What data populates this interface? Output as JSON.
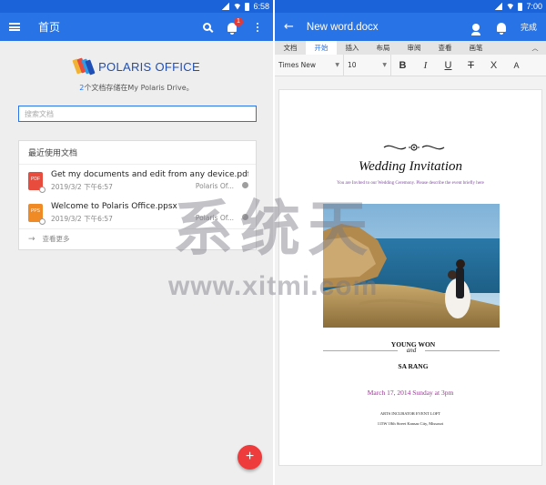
{
  "left": {
    "status": {
      "time": "6:58"
    },
    "appbar": {
      "title": "首页",
      "notification_count": "1"
    },
    "logo": {
      "text": "POLARIS OFFICE"
    },
    "drive_info": {
      "count": "2",
      "suffix": "个文档存储在My Polaris Drive。"
    },
    "search": {
      "placeholder": "搜索文档"
    },
    "recent": {
      "heading": "最近使用文档",
      "files": [
        {
          "name": "Get my documents and edit from any device.pdf",
          "date": "2019/3/2 下午6:57",
          "location": "Polaris Of...",
          "type": "PDF",
          "color": "#e84c3d"
        },
        {
          "name": "Welcome to Polaris Office.ppsx",
          "date": "2019/3/2 下午6:57",
          "location": "Polaris Of...",
          "type": "PPS",
          "color": "#f08a24"
        }
      ],
      "see_more": "查看更多"
    },
    "fab_label": "+"
  },
  "right": {
    "status": {
      "time": "7:00"
    },
    "appbar": {
      "title": "New word.docx",
      "done_label": "完成"
    },
    "tabs": [
      "文档",
      "开始",
      "插入",
      "布局",
      "审阅",
      "查看",
      "画笔"
    ],
    "active_tab": "开始",
    "format": {
      "font": "Times New",
      "size": "10",
      "buttons": [
        "B",
        "I",
        "U",
        "T",
        "X",
        "A"
      ]
    },
    "document": {
      "title": "Wedding Invitation",
      "subtitle": "You are Invited to our Wedding Ceremony. Please describe the event briefly here",
      "groom": "YOUNG WON",
      "and_word": "and",
      "bride": "SA RANG",
      "date": "March 17, 2014 Sunday at 3pm",
      "venue": "ARTS INCUBATOR EVENT LOFT",
      "address": "115W 18th Street Kansas City, Missouri"
    }
  },
  "watermark": {
    "chars": [
      "系",
      "统",
      "天"
    ],
    "url": "www.xitmi.com"
  },
  "colors": {
    "brand_blue": "#2874e6",
    "status_blue": "#1a63d8",
    "fab_red": "#ee3b3b",
    "date_purple": "#a0359a"
  }
}
